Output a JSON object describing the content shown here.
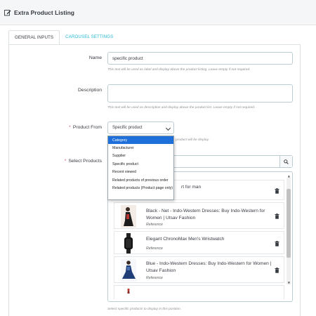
{
  "header": {
    "title": "Extra Product Listing",
    "icon": "edit-icon"
  },
  "tabs": [
    {
      "label": "GENERAL INPUTS",
      "active": true
    },
    {
      "label": "CAROUSEL SETTINGS",
      "active": false
    }
  ],
  "form": {
    "name": {
      "label": "Name",
      "value": "specific product",
      "help": "This text will be used as label and display above the product listing. Leave empty if not required."
    },
    "description": {
      "label": "Description",
      "value": "",
      "help": "This text will be used as description and display above the product list. Leave empty if not required."
    },
    "product_from": {
      "label": "Product From",
      "required_mark": "*",
      "selected": "Specific product",
      "help_tail": "product will be display.",
      "options": [
        "Category",
        "Manufacturer",
        "Supplier",
        "Specific product",
        "Recent viewed",
        "Related products of previous order",
        "Related products (Product page only)"
      ],
      "highlighted_option_index": 0
    },
    "select_products": {
      "label": "Select Products",
      "required_mark": "*",
      "search_value": "",
      "help": "Select specific products to display in this position.",
      "items": [
        {
          "name": "rt for man",
          "reference": ""
        },
        {
          "name": "Black - Net - Indo-Western Dresses: Buy Indo-Western for Women | Utsav Fashion",
          "reference": "Reference"
        },
        {
          "name": "Elegant ChronoMax Men's Wristwatch",
          "reference": "Reference"
        },
        {
          "name": "Blue - Indo-Western Dresses: Buy Indo-Western for Women | Utsav Fashion",
          "reference": "Reference"
        }
      ]
    }
  },
  "colors": {
    "accent": "#25b9d7",
    "dropdown_highlight": "#1e6fd9",
    "required": "#c05c67"
  }
}
